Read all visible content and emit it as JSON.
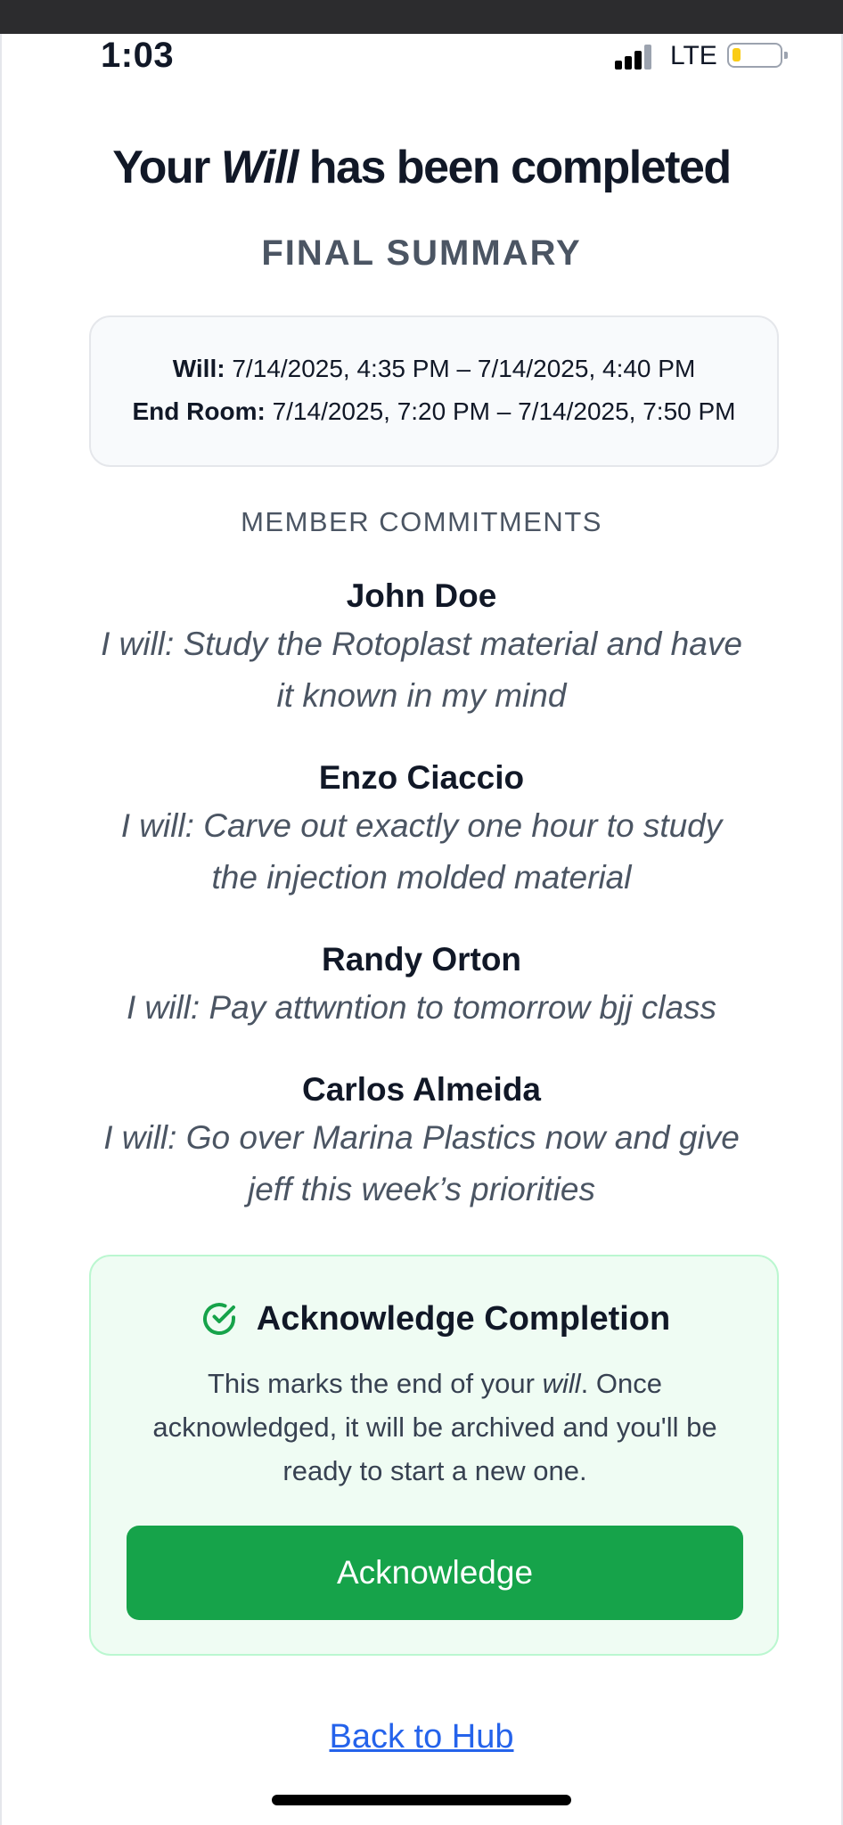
{
  "status_bar": {
    "time": "1:03",
    "network": "LTE",
    "battery_level": 0.15
  },
  "header": {
    "title_prefix": "Your ",
    "title_emphasis": "Will",
    "title_suffix": " has been completed",
    "subtitle": "FINAL SUMMARY"
  },
  "summary": {
    "will_label": "Will:",
    "will_value": "7/14/2025, 4:35 PM – 7/14/2025, 4:40 PM",
    "end_room_label": "End Room:",
    "end_room_value": "7/14/2025, 7:20 PM – 7/14/2025, 7:50 PM"
  },
  "commitments": {
    "heading": "MEMBER COMMITMENTS",
    "members": [
      {
        "name": "John Doe",
        "line1": "I will: Study the Rotoplast material and have",
        "line2": "it known in my mind"
      },
      {
        "name": "Enzo Ciaccio",
        "line1": "I will: Carve out exactly one hour to study",
        "line2": "the injection molded material"
      },
      {
        "name": "Randy Orton",
        "line1": "I will: Pay attwntion to tomorrow bjj class",
        "line2": ""
      },
      {
        "name": "Carlos Almeida",
        "line1": "I will: Go over Marina Plastics now and give",
        "line2": "jeff this week’s priorities"
      }
    ]
  },
  "acknowledge": {
    "title": "Acknowledge Completion",
    "text_prefix": "This marks the end of your ",
    "text_emphasis": "will",
    "text_line1_rest": ". Once",
    "text_line2": "acknowledged, it will be archived and you'll be",
    "text_line3": "ready to start a new one.",
    "button_label": "Acknowledge",
    "accent_color": "#16a34a"
  },
  "footer": {
    "back_link": "Back to Hub",
    "link_color": "#2563eb"
  }
}
